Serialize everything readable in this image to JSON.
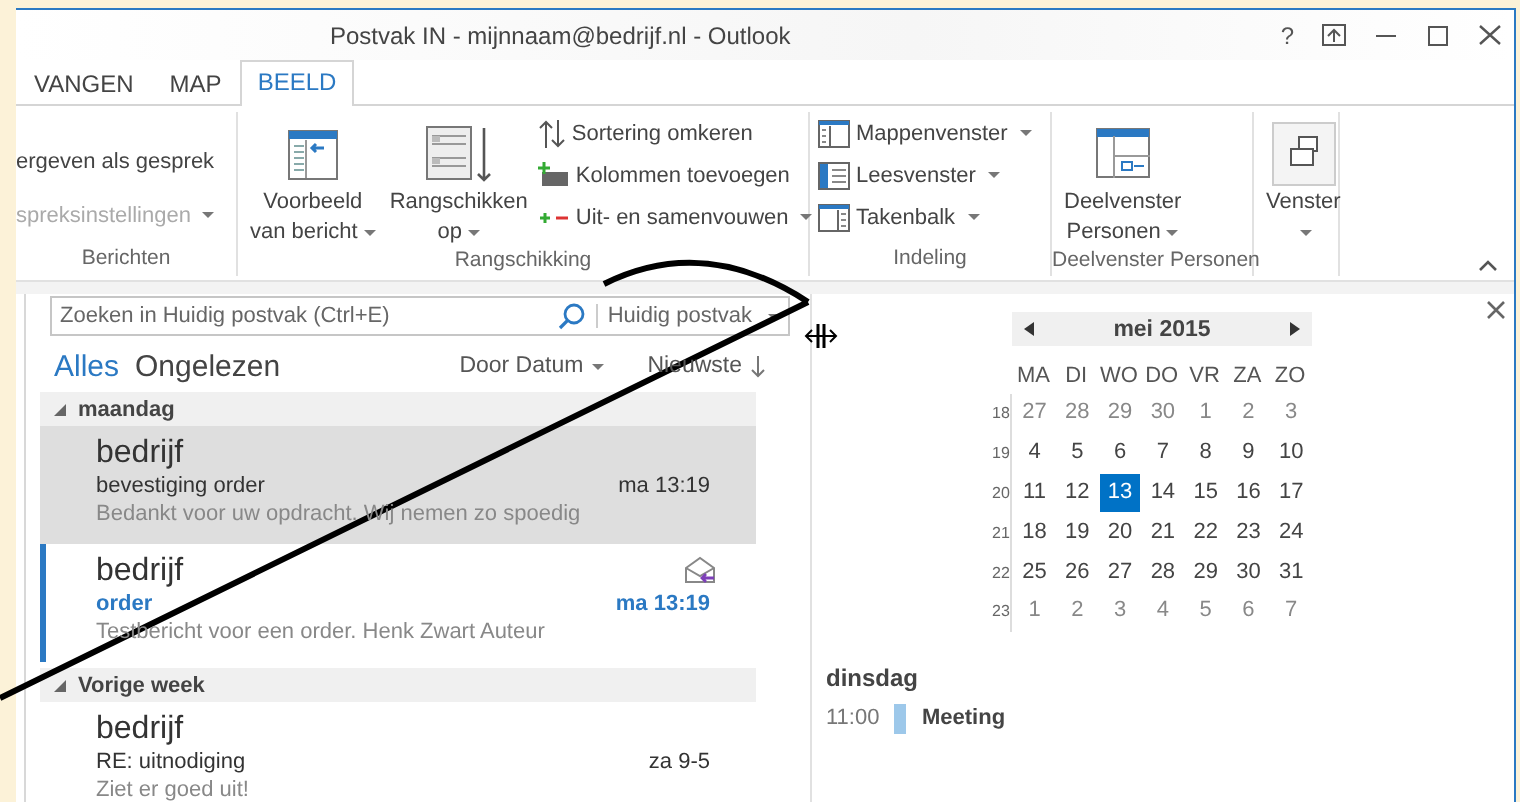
{
  "window": {
    "title": "Postvak IN - mijnnaam@bedrijf.nl - Outlook",
    "help": "?"
  },
  "tabs": [
    {
      "label": "VANGEN",
      "selected": false
    },
    {
      "label": "MAP",
      "selected": false
    },
    {
      "label": "BEELD",
      "selected": true
    }
  ],
  "ribbon": {
    "groups": [
      {
        "label": "Berichten",
        "columns": [
          {
            "kind": "small",
            "buttons": [
              {
                "label": "ergeven als gesprek",
                "dropdown": false,
                "disabled": false
              },
              {
                "label": "spreksinstellingen",
                "dropdown": true,
                "disabled": true
              }
            ]
          }
        ]
      },
      {
        "label": "Rangschikking",
        "columns": [
          {
            "kind": "large",
            "lines": [
              "Voorbeeld",
              "van bericht"
            ],
            "dropdown": true
          },
          {
            "kind": "large",
            "lines": [
              "Rangschikken",
              "op"
            ],
            "dropdown": true
          },
          {
            "kind": "small",
            "buttons": [
              {
                "label": "Sortering omkeren",
                "dropdown": false,
                "disabled": false
              },
              {
                "label": "Kolommen toevoegen",
                "dropdown": false,
                "disabled": false
              },
              {
                "label": "Uit- en samenvouwen",
                "dropdown": true,
                "disabled": false
              }
            ]
          }
        ]
      },
      {
        "label": "Indeling",
        "columns": [
          {
            "kind": "small",
            "buttons": [
              {
                "label": "Mappenvenster",
                "dropdown": true,
                "disabled": false
              },
              {
                "label": "Leesvenster",
                "dropdown": true,
                "disabled": false
              },
              {
                "label": "Takenbalk",
                "dropdown": true,
                "disabled": false
              }
            ]
          }
        ]
      },
      {
        "label": "Deelvenster Personen",
        "columns": [
          {
            "kind": "large",
            "lines": [
              "Deelvenster",
              "Personen"
            ],
            "dropdown": true
          }
        ]
      },
      {
        "columns": [
          {
            "kind": "large",
            "lines": [
              "Venster"
            ],
            "dropdown": true
          }
        ]
      }
    ]
  },
  "search": {
    "placeholder": "Zoeken in Huidig postvak (Ctrl+E)",
    "scope": "Huidig postvak"
  },
  "filters": [
    {
      "label": "Alles",
      "selected": true
    },
    {
      "label": "Ongelezen",
      "selected": false
    }
  ],
  "sort": {
    "by": "Door Datum",
    "order": "Nieuwste"
  },
  "mail_groups": [
    {
      "label": "maandag",
      "expanded": true,
      "messages": [
        {
          "sender": "bedrijf",
          "subject": "bevestiging order",
          "time": "ma 13:19",
          "preview": "Bedankt voor uw opdracht. Wij nemen zo spoedig",
          "selected": true,
          "unread": false,
          "replied": false
        },
        {
          "sender": "bedrijf",
          "subject": "order",
          "time": "ma 13:19",
          "preview": "Testbericht voor een order.  Henk Zwart  Auteur",
          "selected": false,
          "unread": true,
          "replied": true
        }
      ]
    },
    {
      "label": "Vorige week",
      "expanded": true,
      "messages": [
        {
          "sender": "bedrijf",
          "subject": "RE: uitnodiging",
          "time": "za 9-5",
          "preview": "Ziet er goed uit!",
          "selected": false,
          "unread": false,
          "replied": false
        }
      ]
    }
  ],
  "calendar": {
    "month": "mei 2015",
    "weekdays": [
      "MA",
      "DI",
      "WO",
      "DO",
      "VR",
      "ZA",
      "ZO"
    ],
    "weeks": [
      {
        "number": "18",
        "days": [
          {
            "label": "27",
            "dimmed": true,
            "selected": false
          },
          {
            "label": "28",
            "dimmed": true,
            "selected": false
          },
          {
            "label": "29",
            "dimmed": true,
            "selected": false
          },
          {
            "label": "30",
            "dimmed": true,
            "selected": false
          },
          {
            "label": "1",
            "dimmed": true,
            "selected": false
          },
          {
            "label": "2",
            "dimmed": true,
            "selected": false
          },
          {
            "label": "3",
            "dimmed": true,
            "selected": false
          }
        ]
      },
      {
        "number": "19",
        "days": [
          {
            "label": "4",
            "dimmed": false,
            "selected": false
          },
          {
            "label": "5",
            "dimmed": false,
            "selected": false
          },
          {
            "label": "6",
            "dimmed": false,
            "selected": false
          },
          {
            "label": "7",
            "dimmed": false,
            "selected": false
          },
          {
            "label": "8",
            "dimmed": false,
            "selected": false
          },
          {
            "label": "9",
            "dimmed": false,
            "selected": false
          },
          {
            "label": "10",
            "dimmed": false,
            "selected": false
          }
        ]
      },
      {
        "number": "20",
        "days": [
          {
            "label": "11",
            "dimmed": false,
            "selected": false
          },
          {
            "label": "12",
            "dimmed": false,
            "selected": false
          },
          {
            "label": "13",
            "dimmed": false,
            "selected": true
          },
          {
            "label": "14",
            "dimmed": false,
            "selected": false
          },
          {
            "label": "15",
            "dimmed": false,
            "selected": false
          },
          {
            "label": "16",
            "dimmed": false,
            "selected": false
          },
          {
            "label": "17",
            "dimmed": false,
            "selected": false
          }
        ]
      },
      {
        "number": "21",
        "days": [
          {
            "label": "18",
            "dimmed": false,
            "selected": false
          },
          {
            "label": "19",
            "dimmed": false,
            "selected": false
          },
          {
            "label": "20",
            "dimmed": false,
            "selected": false
          },
          {
            "label": "21",
            "dimmed": false,
            "selected": false
          },
          {
            "label": "22",
            "dimmed": false,
            "selected": false
          },
          {
            "label": "23",
            "dimmed": false,
            "selected": false
          },
          {
            "label": "24",
            "dimmed": false,
            "selected": false
          }
        ]
      },
      {
        "number": "22",
        "days": [
          {
            "label": "25",
            "dimmed": false,
            "selected": false
          },
          {
            "label": "26",
            "dimmed": false,
            "selected": false
          },
          {
            "label": "27",
            "dimmed": false,
            "selected": false
          },
          {
            "label": "28",
            "dimmed": false,
            "selected": false
          },
          {
            "label": "29",
            "dimmed": false,
            "selected": false
          },
          {
            "label": "30",
            "dimmed": false,
            "selected": false
          },
          {
            "label": "31",
            "dimmed": false,
            "selected": false
          }
        ]
      },
      {
        "number": "23",
        "days": [
          {
            "label": "1",
            "dimmed": true,
            "selected": false
          },
          {
            "label": "2",
            "dimmed": true,
            "selected": false
          },
          {
            "label": "3",
            "dimmed": true,
            "selected": false
          },
          {
            "label": "4",
            "dimmed": true,
            "selected": false
          },
          {
            "label": "5",
            "dimmed": true,
            "selected": false
          },
          {
            "label": "6",
            "dimmed": true,
            "selected": false
          },
          {
            "label": "7",
            "dimmed": true,
            "selected": false
          }
        ]
      }
    ]
  },
  "agenda": {
    "day": "dinsdag",
    "items": [
      {
        "time": "11:00",
        "title": "Meeting"
      }
    ]
  }
}
